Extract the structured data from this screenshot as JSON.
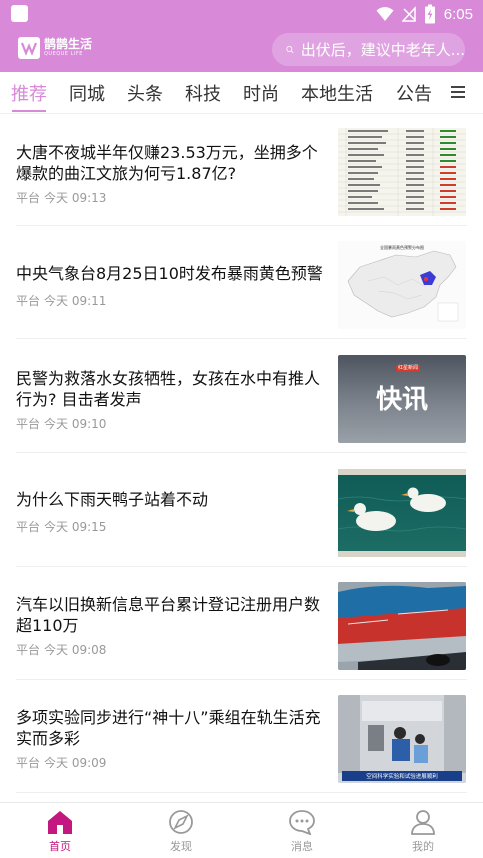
{
  "status_bar": {
    "time": "6:05"
  },
  "header": {
    "logo_name": "鹊鹊生活",
    "logo_sub": "QUEQUE LIFE",
    "search_placeholder": "出伏后，建议中老年人..."
  },
  "tabs": [
    {
      "label": "推荐",
      "active": true
    },
    {
      "label": "同城"
    },
    {
      "label": "头条"
    },
    {
      "label": "科技"
    },
    {
      "label": "时尚"
    },
    {
      "label": "本地生活"
    },
    {
      "label": "公告"
    }
  ],
  "feed": [
    {
      "title": "大唐不夜城半年仅赚23.53万元，坐拥多个爆款的曲江文旅为何亏1.87亿?",
      "source": "平台",
      "time": "今天 09:13",
      "thumb": "table-chart"
    },
    {
      "title": "中央气象台8月25日10时发布暴雨黄色预警",
      "source": "平台",
      "time": "今天 09:11",
      "thumb": "weather-map",
      "thumb_text": "全国暴雨黄色预警分布图"
    },
    {
      "title": "民警为救落水女孩牺牲，女孩在水中有推人行为? 目击者发声",
      "source": "平台",
      "time": "今天 09:10",
      "thumb": "news-flash",
      "thumb_text": "快讯",
      "thumb_tag": "红星新闻"
    },
    {
      "title": "为什么下雨天鸭子站着不动",
      "source": "平台",
      "time": "今天 09:15",
      "thumb": "ducks"
    },
    {
      "title": "汽车以旧换新信息平台累计登记注册用户数超110万",
      "source": "平台",
      "time": "今天 09:08",
      "thumb": "cars"
    },
    {
      "title": "多项实验同步进行“神十八”乘组在轨生活充实而多彩",
      "source": "平台",
      "time": "今天 09:09",
      "thumb": "space-station",
      "thumb_text": "空间科学实验和试验进展顺利"
    }
  ],
  "bottom_nav": [
    {
      "label": "首页",
      "icon": "home-icon",
      "active": true
    },
    {
      "label": "发现",
      "icon": "compass-icon"
    },
    {
      "label": "消息",
      "icon": "message-icon"
    },
    {
      "label": "我的",
      "icon": "user-icon"
    }
  ],
  "colors": {
    "accent": "#d88ad9",
    "active_nav": "#c2187f"
  }
}
